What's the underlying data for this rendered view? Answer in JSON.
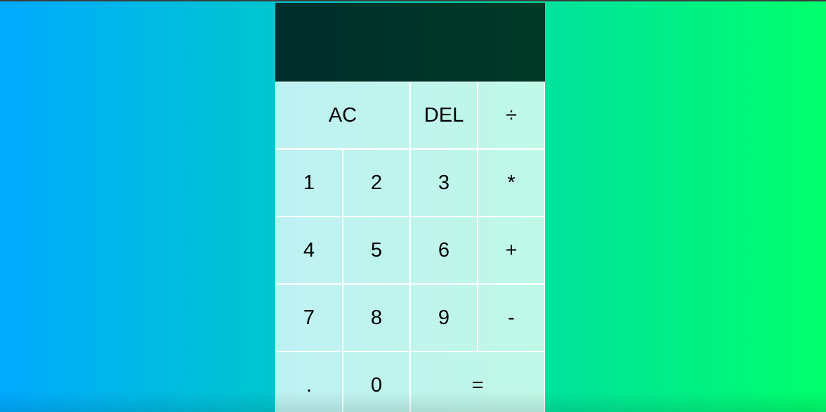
{
  "calculator": {
    "display": {
      "previous_operand": "",
      "current_operand": ""
    },
    "keys": {
      "ac": "AC",
      "del": "DEL",
      "divide": "÷",
      "one": "1",
      "two": "2",
      "three": "3",
      "multiply": "*",
      "four": "4",
      "five": "5",
      "six": "6",
      "plus": "+",
      "seven": "7",
      "eight": "8",
      "nine": "9",
      "minus": "-",
      "decimal": ".",
      "zero": "0",
      "equals": "="
    }
  },
  "colors": {
    "background_start": "#00aaff",
    "background_end": "#00ff6c",
    "display_background": "#002e2c",
    "key_background": "#bff3ea"
  }
}
